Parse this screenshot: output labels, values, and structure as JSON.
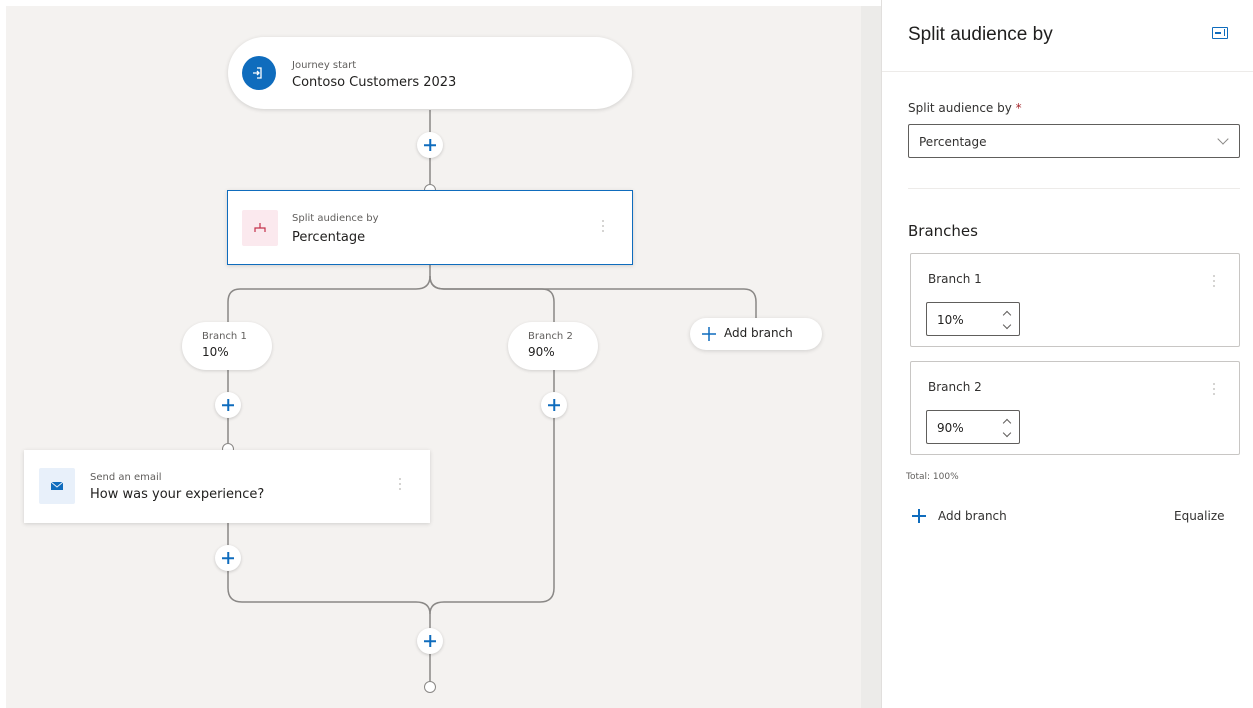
{
  "journey_start": {
    "subtitle": "Journey start",
    "title": "Contoso Customers 2023",
    "icon": "journey-start-icon"
  },
  "split_node": {
    "subtitle": "Split audience by",
    "title": "Percentage",
    "icon": "split-icon"
  },
  "branches": [
    {
      "name": "Branch 1",
      "value": "10%"
    },
    {
      "name": "Branch 2",
      "value": "90%"
    }
  ],
  "add_branch_canvas_label": "Add branch",
  "email_node": {
    "subtitle": "Send an email",
    "title": "How was your experience?",
    "icon": "email-icon"
  },
  "panel": {
    "title": "Split audience by",
    "field_label": "Split audience by",
    "required_mark": "*",
    "selected": "Percentage",
    "branches_heading": "Branches",
    "branch_cards": [
      {
        "name": "Branch 1",
        "value": "10%"
      },
      {
        "name": "Branch 2",
        "value": "90%"
      }
    ],
    "total": "Total: 100%",
    "add_branch": "Add branch",
    "equalize": "Equalize"
  },
  "colors": {
    "accent": "#0f6cbd",
    "canvas_bg": "#f4f2f0",
    "connector": "#8a8886",
    "split_icon_bg": "#fbe9ee",
    "split_icon_fg": "#c4314b",
    "email_icon_bg": "#e8f0fa"
  }
}
